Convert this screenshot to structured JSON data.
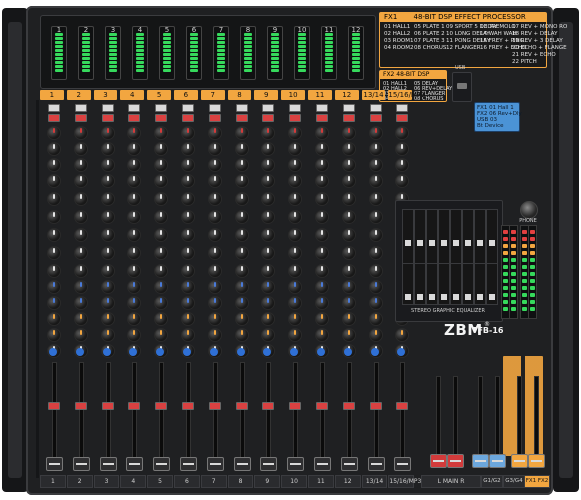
{
  "device": {
    "brand": "ZBM",
    "registered": "®",
    "model": "TFB-16"
  },
  "fx1": {
    "header_left": "FX1",
    "header_right": "48-BIT DSP EFFECT PROCESSOR",
    "rows": [
      [
        "01 HALL1",
        "05 PLATE 1",
        "09 SPORT 5 DELAY",
        "13 TREMOLO",
        "17 REV + MONO RO"
      ],
      [
        "02 HALL2",
        "06 PLATE 2",
        "10 LONG DELAY",
        "14 WAH WAH",
        "18 REV + DELAY"
      ],
      [
        "03 ROOM1",
        "07 PLATE 3",
        "11 PONG DELAY",
        "15 FREY + PING",
        "19 REV + 3 DELAY"
      ],
      [
        "04 ROOM2",
        "08 CHORUS",
        "12 FLANGER",
        "16 FREY + ECHO",
        "20 ECHO + FLANGE"
      ],
      [
        "",
        "",
        "",
        "",
        "21 REV + ECHO"
      ],
      [
        "",
        "",
        "",
        "",
        "22 PITCH"
      ]
    ]
  },
  "fx2": {
    "header": "FX2  48-BIT DSP EFFECT",
    "rows": [
      [
        "01 HALL1",
        "05 DELAY"
      ],
      [
        "02 HALL2",
        "06 REV+DELAY"
      ],
      [
        "03 ROOM1",
        "07 FLANGER"
      ],
      [
        "04 ROOM2",
        "08 CHORUS"
      ]
    ]
  },
  "lcd": {
    "lines": [
      "FX1 01 Hall 1",
      "FX2 06 Rev+Dly",
      "USB 03",
      "Bt Device"
    ]
  },
  "channels": [
    "1",
    "2",
    "3",
    "4",
    "5",
    "6",
    "7",
    "8",
    "9",
    "10",
    "11",
    "12",
    "13/14",
    "15/16/MP3"
  ],
  "meters": [
    "1",
    "2",
    "3",
    "4",
    "5",
    "6",
    "7",
    "8",
    "9",
    "10",
    "11",
    "12"
  ],
  "bottom_labels": [
    "1",
    "2",
    "3",
    "4",
    "5",
    "6",
    "7",
    "8",
    "9",
    "10",
    "11",
    "12",
    "13/14",
    "15/16/MP3"
  ],
  "main": {
    "label": "L  MAIN  R",
    "group1": "G1/G2",
    "group2": "G3/G4",
    "fx_labels": [
      "FX1",
      "FX2"
    ]
  },
  "geq_label": "STEREO GRAPHIC EQUALIZER",
  "phones_label": "PHONE",
  "usb_label": "USB",
  "colors": {
    "accent": "#f2a640",
    "panel": "#1f2022",
    "knob_red": "#d23b3b",
    "knob_blue": "#4a7ad8",
    "lcd": "#4b93d6",
    "meter_green": "#36d95c"
  }
}
